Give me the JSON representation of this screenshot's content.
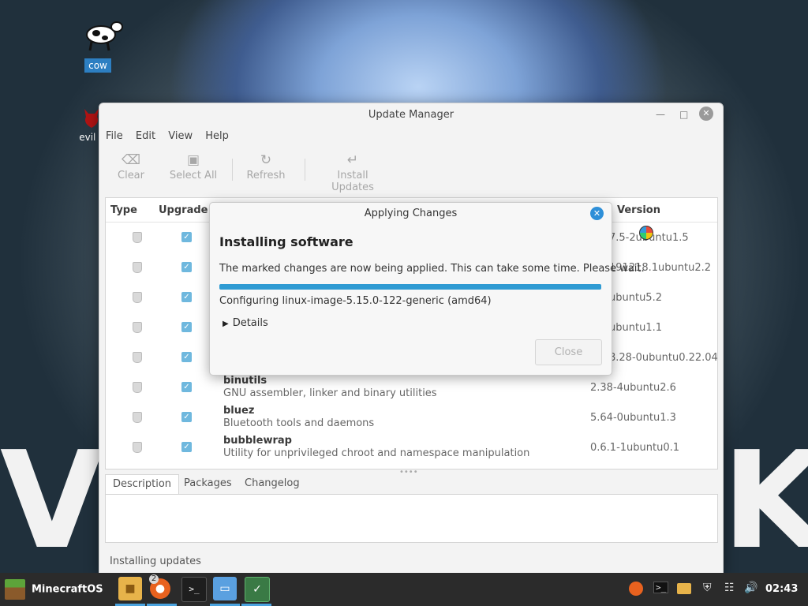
{
  "desktop": {
    "icons": [
      {
        "label": "cow"
      },
      {
        "label": "evil c"
      }
    ],
    "background_text": [
      "V",
      "K"
    ]
  },
  "window": {
    "title": "Update Manager",
    "menu": [
      "File",
      "Edit",
      "View",
      "Help"
    ],
    "toolbar": {
      "clear": "Clear",
      "select_all": "Select All",
      "refresh": "Refresh",
      "install_updates": "Install Updates"
    },
    "columns": {
      "type": "Type",
      "upgrade": "Upgrade",
      "version": "Version"
    },
    "rows": [
      {
        "name": "",
        "desc": "",
        "version": "7.5-2ubuntu1.5"
      },
      {
        "name": "",
        "desc": "",
        "version": "191218.1ubuntu2.2"
      },
      {
        "name": "",
        "desc": "",
        "version": "ubuntu5.2"
      },
      {
        "name": "",
        "desc": "",
        "version": "ubuntu1.1"
      },
      {
        "name": "",
        "desc": "",
        "version": "8.28-0ubuntu0.22.04."
      },
      {
        "name": "binutils",
        "desc": "GNU assembler, linker and binary utilities",
        "version": "2.38-4ubuntu2.6"
      },
      {
        "name": "bluez",
        "desc": "Bluetooth tools and daemons",
        "version": "5.64-0ubuntu1.3"
      },
      {
        "name": "bubblewrap",
        "desc": "Utility for unprivileged chroot and namespace manipulation",
        "version": "0.6.1-1ubuntu0.1"
      }
    ],
    "tabs": [
      "Description",
      "Packages",
      "Changelog"
    ],
    "status": "Installing updates"
  },
  "dialog": {
    "title": "Applying Changes",
    "heading": "Installing software",
    "message": "The marked changes are now being applied. This can take some time. Please wait.",
    "progress": 1.0,
    "status": "Configuring linux-image-5.15.0-122-generic (amd64)",
    "details": "Details",
    "close_button": "Close"
  },
  "taskbar": {
    "start_label": "MinecraftOS",
    "firefox_badge": "2",
    "clock": "02:43"
  }
}
